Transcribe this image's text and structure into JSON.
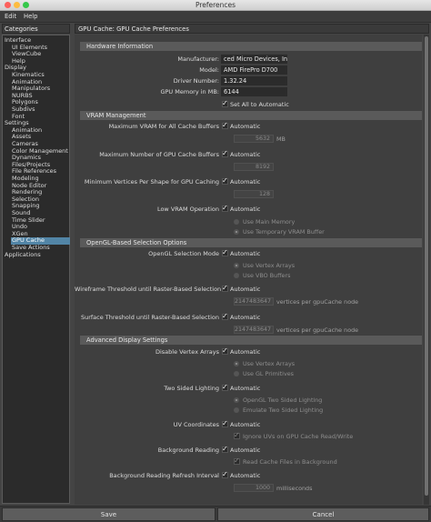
{
  "window": {
    "title": "Preferences"
  },
  "menu": {
    "edit": "Edit",
    "help": "Help"
  },
  "sidebar": {
    "header": "Categories",
    "items": [
      {
        "label": "Interface",
        "level": 0
      },
      {
        "label": "UI Elements",
        "level": 1
      },
      {
        "label": "ViewCube",
        "level": 1
      },
      {
        "label": "Help",
        "level": 1
      },
      {
        "label": "Display",
        "level": 0
      },
      {
        "label": "Kinematics",
        "level": 1
      },
      {
        "label": "Animation",
        "level": 1
      },
      {
        "label": "Manipulators",
        "level": 1
      },
      {
        "label": "NURBS",
        "level": 1
      },
      {
        "label": "Polygons",
        "level": 1
      },
      {
        "label": "Subdivs",
        "level": 1
      },
      {
        "label": "Font",
        "level": 1
      },
      {
        "label": "Settings",
        "level": 0
      },
      {
        "label": "Animation",
        "level": 1
      },
      {
        "label": "Assets",
        "level": 1
      },
      {
        "label": "Cameras",
        "level": 1
      },
      {
        "label": "Color Management",
        "level": 1
      },
      {
        "label": "Dynamics",
        "level": 1
      },
      {
        "label": "Files/Projects",
        "level": 1
      },
      {
        "label": "File References",
        "level": 1
      },
      {
        "label": "Modeling",
        "level": 1
      },
      {
        "label": "Node Editor",
        "level": 1
      },
      {
        "label": "Rendering",
        "level": 1
      },
      {
        "label": "Selection",
        "level": 1
      },
      {
        "label": "Snapping",
        "level": 1
      },
      {
        "label": "Sound",
        "level": 1
      },
      {
        "label": "Time Slider",
        "level": 1
      },
      {
        "label": "Undo",
        "level": 1
      },
      {
        "label": "XGen",
        "level": 1
      },
      {
        "label": "GPU Cache",
        "level": 1,
        "selected": true
      },
      {
        "label": "Save Actions",
        "level": 1
      },
      {
        "label": "Applications",
        "level": 0
      }
    ]
  },
  "panel": {
    "header": "GPU Cache: GPU Cache Preferences",
    "hardware": {
      "title": "Hardware Information",
      "manufacturer_label": "Manufacturer:",
      "manufacturer_value": "ced Micro Devices, Inc.",
      "model_label": "Model:",
      "model_value": "AMD FirePro D700",
      "driver_label": "Driver Number:",
      "driver_value": "1.32.24",
      "memory_label": "GPU Memory in MB:",
      "memory_value": "6144",
      "set_all_label": "Set All to Automatic"
    },
    "vram": {
      "title": "VRAM Management",
      "max_vram_label": "Maximum VRAM for All Cache Buffers",
      "max_vram_value": "5632",
      "max_vram_unit": "MB",
      "max_buffers_label": "Maximum Number of GPU Cache Buffers",
      "max_buffers_value": "8192",
      "min_vertices_label": "Minimum Vertices Per Shape for GPU Caching",
      "min_vertices_value": "128",
      "low_vram_label": "Low VRAM Operation",
      "opt_main_memory": "Use Main Memory",
      "opt_temp_vram": "Use Temporary VRAM Buffer"
    },
    "opengl": {
      "title": "OpenGL-Based Selection Options",
      "selection_mode_label": "OpenGL Selection Mode",
      "opt_vertex_arrays": "Use Vertex Arrays",
      "opt_vbo": "Use VBO Buffers",
      "wireframe_label": "Wireframe Threshold until Raster-Based Selection",
      "wireframe_value": "2147483647",
      "wireframe_unit": "vertices per gpuCache node",
      "surface_label": "Surface Threshold until Raster-Based Selection",
      "surface_value": "2147483647",
      "surface_unit": "vertices per gpuCache node"
    },
    "advanced": {
      "title": "Advanced Display Settings",
      "disable_va_label": "Disable Vertex Arrays",
      "opt_use_va": "Use Vertex Arrays",
      "opt_gl_primitives": "Use GL Primitives",
      "two_sided_label": "Two Sided Lighting",
      "opt_opengl_two_sided": "OpenGL Two Sided Lighting",
      "opt_emulate_two_sided": "Emulate Two Sided Lighting",
      "uv_label": "UV Coordinates",
      "ignore_uvs_label": "Ignore UVs on GPU Cache Read/Write",
      "bg_reading_label": "Background Reading",
      "read_bg_label": "Read Cache Files in Background",
      "bg_refresh_label": "Background Reading Refresh Interval",
      "bg_refresh_value": "1000",
      "bg_refresh_unit": "milliseconds"
    },
    "automatic_label": "Automatic"
  },
  "buttons": {
    "save": "Save",
    "cancel": "Cancel"
  }
}
